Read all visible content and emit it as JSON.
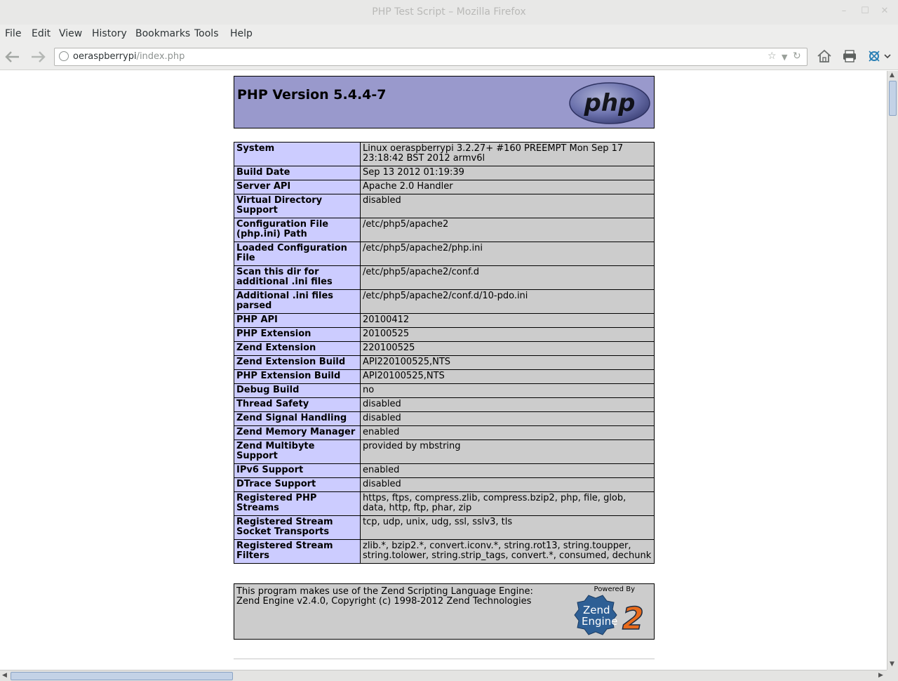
{
  "window": {
    "title": "PHP Test Script – Mozilla Firefox"
  },
  "menu": [
    "File",
    "Edit",
    "View",
    "History",
    "Bookmarks",
    "Tools",
    "Help"
  ],
  "url": {
    "host": "oeraspberrypi",
    "path": "/index.php"
  },
  "icons": {
    "back": "back-arrow-icon",
    "forward": "forward-arrow-icon",
    "home": "home-icon",
    "print": "printer-icon",
    "addon": "addon-icon",
    "bookmark": "star-icon",
    "reload": "reload-icon"
  },
  "page": {
    "version": "PHP Version 5.4.4-7",
    "logo_text": "php",
    "rows": [
      {
        "key": "System",
        "value": "Linux oeraspberrypi 3.2.27+ #160 PREEMPT Mon Sep 17 23:18:42 BST 2012 armv6l"
      },
      {
        "key": "Build Date",
        "value": "Sep 13 2012 01:19:39"
      },
      {
        "key": "Server API",
        "value": "Apache 2.0 Handler"
      },
      {
        "key": "Virtual Directory Support",
        "value": "disabled"
      },
      {
        "key": "Configuration File (php.ini) Path",
        "value": "/etc/php5/apache2"
      },
      {
        "key": "Loaded Configuration File",
        "value": "/etc/php5/apache2/php.ini"
      },
      {
        "key": "Scan this dir for additional .ini files",
        "value": "/etc/php5/apache2/conf.d"
      },
      {
        "key": "Additional .ini files parsed",
        "value": "/etc/php5/apache2/conf.d/10-pdo.ini"
      },
      {
        "key": "PHP API",
        "value": "20100412"
      },
      {
        "key": "PHP Extension",
        "value": "20100525"
      },
      {
        "key": "Zend Extension",
        "value": "220100525"
      },
      {
        "key": "Zend Extension Build",
        "value": "API220100525,NTS"
      },
      {
        "key": "PHP Extension Build",
        "value": "API20100525,NTS"
      },
      {
        "key": "Debug Build",
        "value": "no"
      },
      {
        "key": "Thread Safety",
        "value": "disabled"
      },
      {
        "key": "Zend Signal Handling",
        "value": "disabled"
      },
      {
        "key": "Zend Memory Manager",
        "value": "enabled"
      },
      {
        "key": "Zend Multibyte Support",
        "value": "provided by mbstring"
      },
      {
        "key": "IPv6 Support",
        "value": "enabled"
      },
      {
        "key": "DTrace Support",
        "value": "disabled"
      },
      {
        "key": "Registered PHP Streams",
        "value": "https, ftps, compress.zlib, compress.bzip2, php, file, glob, data, http, ftp, phar, zip"
      },
      {
        "key": "Registered Stream Socket Transports",
        "value": "tcp, udp, unix, udg, ssl, sslv3, tls"
      },
      {
        "key": "Registered Stream Filters",
        "value": "zlib.*, bzip2.*, convert.iconv.*, string.rot13, string.toupper, string.tolower, string.strip_tags, convert.*, consumed, dechunk"
      }
    ],
    "zend": {
      "line1": "This program makes use of the Zend Scripting Language Engine:",
      "line2": "Zend Engine v2.4.0, Copyright (c) 1998-2012 Zend Technologies",
      "powered": "Powered By",
      "logo_line1": "Zend",
      "logo_line2": "Engine",
      "logo_num": "2"
    }
  }
}
